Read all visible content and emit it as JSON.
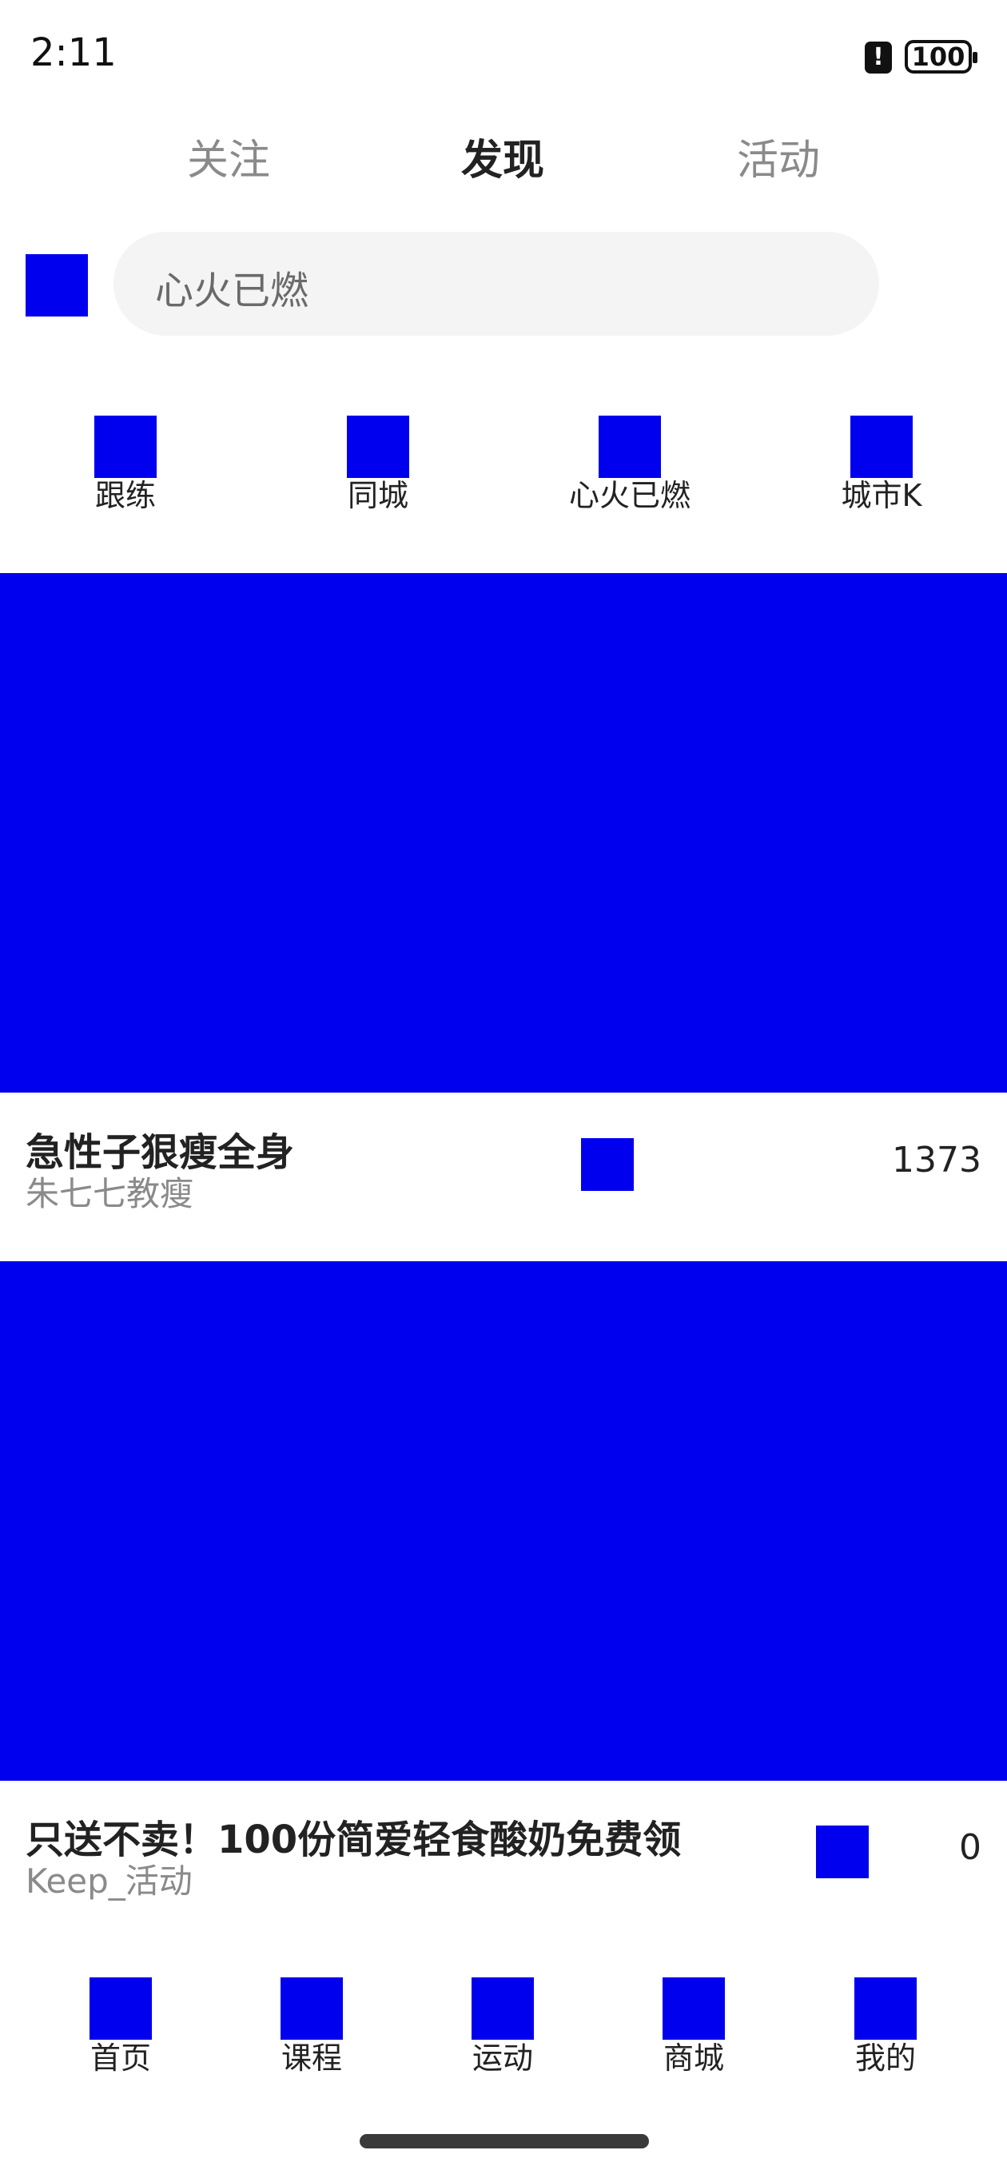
{
  "status_bar": {
    "time": "2:11",
    "battery": "100",
    "alert_icon": "alert-icon"
  },
  "top_tabs": [
    {
      "label": "关注",
      "active": false
    },
    {
      "label": "发现",
      "active": true
    },
    {
      "label": "活动",
      "active": false
    }
  ],
  "search": {
    "icon": "scan-icon",
    "placeholder": "心火已燃"
  },
  "shortcuts": [
    {
      "label": "跟练",
      "icon": "follow-train-icon"
    },
    {
      "label": "同城",
      "icon": "same-city-icon"
    },
    {
      "label": "心火已燃",
      "icon": "heart-fire-icon"
    },
    {
      "label": "城市K",
      "icon": "city-k-icon"
    }
  ],
  "feed": [
    {
      "title": "急性子狠瘦全身",
      "author": "朱七七教瘦",
      "count": "1373",
      "icon": "like-icon"
    },
    {
      "title": "只送不卖！100份简爱轻食酸奶免费领",
      "author": "Keep_活动",
      "count": "0",
      "icon": "like-icon"
    }
  ],
  "bottom_nav": [
    {
      "label": "首页",
      "icon": "home-icon"
    },
    {
      "label": "课程",
      "icon": "course-icon"
    },
    {
      "label": "运动",
      "icon": "sport-icon"
    },
    {
      "label": "商城",
      "icon": "mall-icon"
    },
    {
      "label": "我的",
      "icon": "profile-icon"
    }
  ],
  "colors": {
    "placeholder_blue": "#0000ee",
    "search_bg": "#f4f4f4",
    "muted_text": "#8a8a8a"
  }
}
